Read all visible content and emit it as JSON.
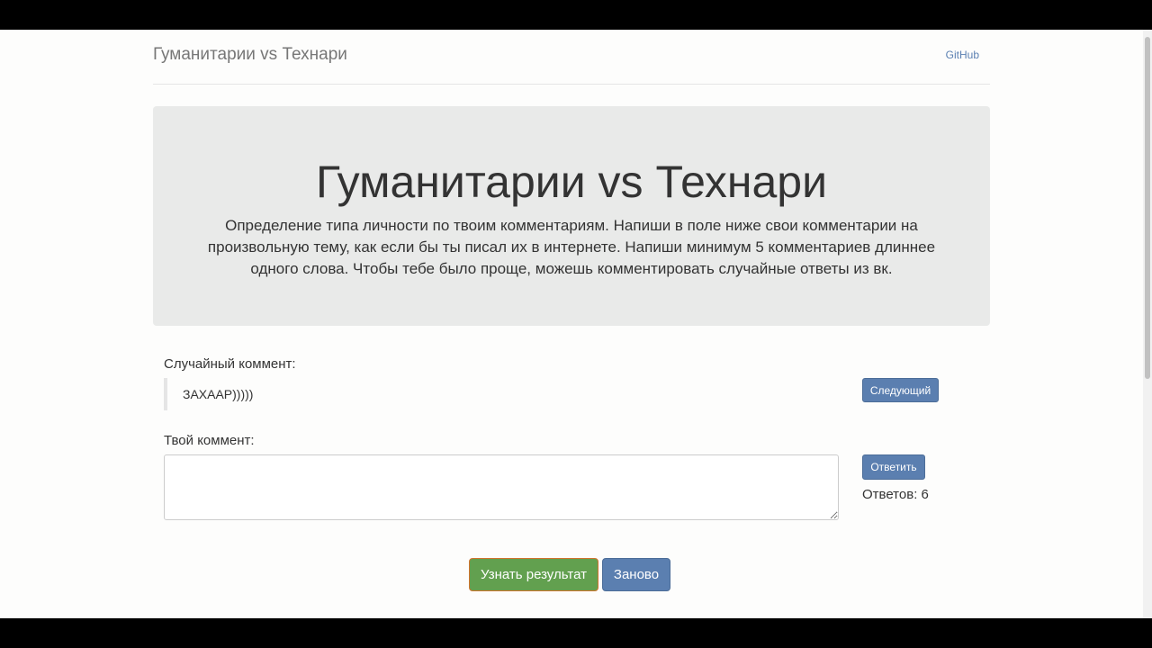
{
  "header": {
    "brand": "Гуманитарии vs Технари",
    "github_link": "GitHub"
  },
  "jumbotron": {
    "title": "Гуманитарии vs Технари",
    "lead": "Определение типа личности по твоим комментариям. Напиши в поле ниже свои комментарии на произвольную тему, как если бы ты писал их в интернете. Напиши минимум 5 комментариев длиннее одного слова. Чтобы тебе было проще, можешь комментировать случайные ответы из вк."
  },
  "random_comment": {
    "label": "Случайный коммент:",
    "text": "ЗАХААР)))))",
    "next_button": "Следующий"
  },
  "your_comment": {
    "label": "Твой коммент:",
    "value": "",
    "placeholder": "",
    "reply_button": "Ответить",
    "answers_count": "Ответов: 6"
  },
  "actions": {
    "result_button": "Узнать результат",
    "restart_button": "Заново"
  },
  "colors": {
    "primary": "#5b7fb0",
    "success": "#62a04f",
    "jumbotron_bg": "#e9eae9"
  }
}
